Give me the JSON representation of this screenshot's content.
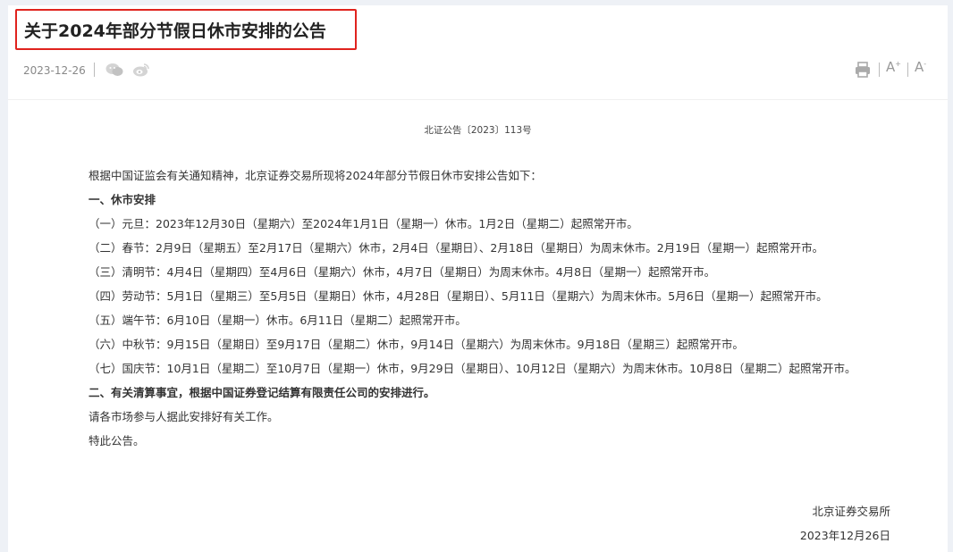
{
  "article": {
    "title": "关于2024年部分节假日休市安排的公告",
    "date": "2023-12-26",
    "doc_number": "北证公告〔2023〕113号",
    "paragraphs": {
      "intro": "根据中国证监会有关通知精神，北京证券交易所现将2024年部分节假日休市安排公告如下：",
      "h1": "一、休市安排",
      "item1": "（一）元旦：2023年12月30日（星期六）至2024年1月1日（星期一）休市。1月2日（星期二）起照常开市。",
      "item2": "（二）春节：2月9日（星期五）至2月17日（星期六）休市，2月4日（星期日）、2月18日（星期日）为周末休市。2月19日（星期一）起照常开市。",
      "item3": "（三）清明节：4月4日（星期四）至4月6日（星期六）休市，4月7日（星期日）为周末休市。4月8日（星期一）起照常开市。",
      "item4": "（四）劳动节：5月1日（星期三）至5月5日（星期日）休市，4月28日（星期日）、5月11日（星期六）为周末休市。5月6日（星期一）起照常开市。",
      "item5": "（五）端午节：6月10日（星期一）休市。6月11日（星期二）起照常开市。",
      "item6": "（六）中秋节：9月15日（星期日）至9月17日（星期二）休市，9月14日（星期六）为周末休市。9月18日（星期三）起照常开市。",
      "item7": "（七）国庆节：10月1日（星期二）至10月7日（星期一）休市，9月29日（星期日）、10月12日（星期六）为周末休市。10月8日（星期二）起照常开市。",
      "h2": "二、有关清算事宜，根据中国证券登记结算有限责任公司的安排进行。",
      "closing1": "请各市场参与人据此安排好有关工作。",
      "closing2": "特此公告。"
    },
    "signature": {
      "org": "北京证券交易所",
      "date": "2023年12月26日"
    }
  },
  "toolbar": {
    "font_increase_label": "A",
    "font_increase_mark": "+",
    "font_decrease_label": "A",
    "font_decrease_mark": "-"
  },
  "icons": {
    "share": [
      "wechat-icon",
      "weibo-icon"
    ],
    "print": "print-icon"
  }
}
